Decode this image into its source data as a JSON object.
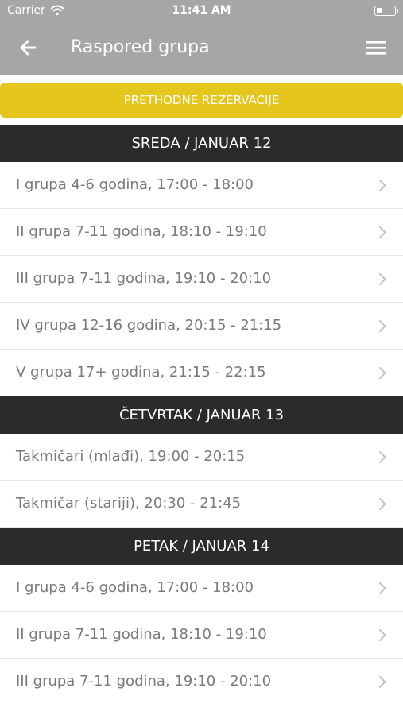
{
  "status": {
    "carrier": "Carrier",
    "time": "11:41 AM"
  },
  "nav": {
    "title": "Raspored grupa"
  },
  "prev_button": "PRETHODNE REZERVACIJE",
  "days": [
    {
      "header": "SREDA / JANUAR 12",
      "items": [
        "I grupa 4-6 godina, 17:00 - 18:00",
        "II grupa 7-11 godina, 18:10 - 19:10",
        "III grupa 7-11 godina, 19:10 - 20:10",
        "IV grupa 12-16 godina, 20:15 - 21:15",
        "V grupa 17+ godina, 21:15 - 22:15"
      ]
    },
    {
      "header": "ČETVRTAK / JANUAR 13",
      "items": [
        "Takmičari (mlađi), 19:00 - 20:15",
        "Takmičar (stariji), 20:30 - 21:45"
      ]
    },
    {
      "header": "PETAK / JANUAR 14",
      "items": [
        "I grupa 4-6 godina, 17:00 - 18:00",
        "II grupa 7-11 godina, 18:10 - 19:10",
        "III grupa 7-11 godina, 19:10 - 20:10"
      ]
    }
  ],
  "colors": {
    "header_bg": "#a6a6a6",
    "accent": "#e4c61c",
    "day_bg": "#2b2b2b",
    "row_text": "#7a7a7a"
  },
  "icons": {
    "back": "arrow-left-icon",
    "menu": "hamburger-menu-icon",
    "row": "chevron-right-icon"
  }
}
